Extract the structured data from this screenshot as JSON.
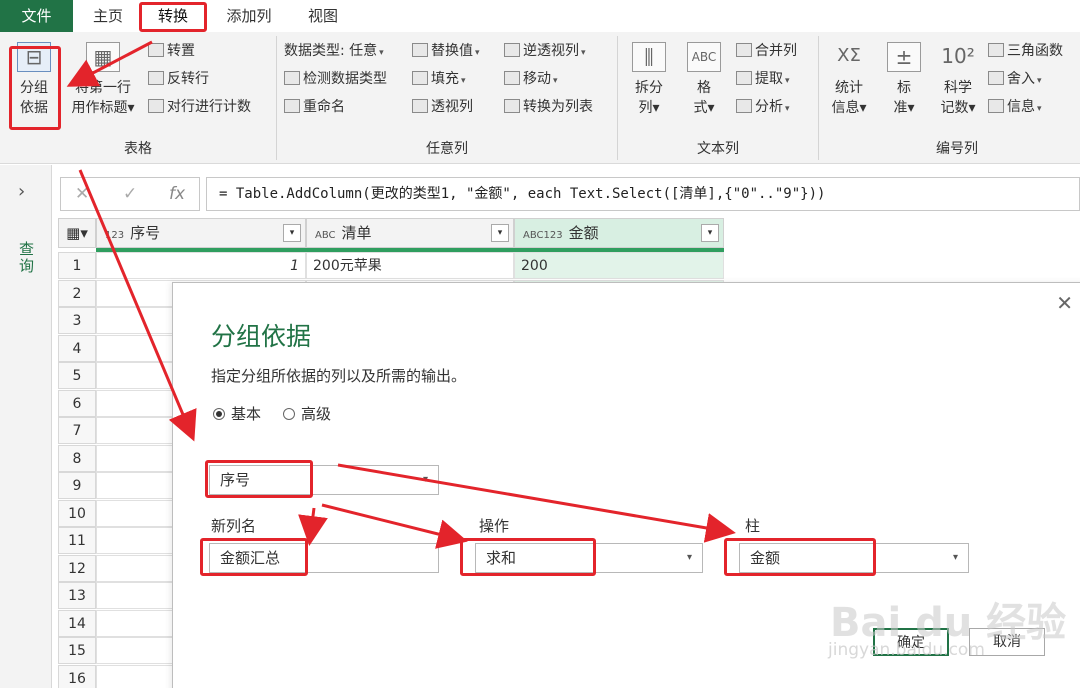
{
  "tabs": {
    "file": "文件",
    "home": "主页",
    "transform": "转换",
    "add_column": "添加列",
    "view": "视图"
  },
  "ribbon": {
    "table": {
      "group_by": [
        "分组",
        "依据"
      ],
      "use_first_row": [
        "将第一行",
        "用作标题"
      ],
      "transpose": "转置",
      "reverse_rows": "反转行",
      "count_rows": "对行进行计数",
      "label": "表格"
    },
    "any_column": {
      "data_type": "数据类型: 任意",
      "detect_type": "检测数据类型",
      "rename": "重命名",
      "replace_values": "替换值",
      "fill": "填充",
      "pivot": "透视列",
      "unpivot": "逆透视列",
      "move": "移动",
      "to_list": "转换为列表",
      "label": "任意列"
    },
    "text_column": {
      "split": [
        "拆分",
        "列"
      ],
      "format": [
        "格",
        "式"
      ],
      "merge": "合并列",
      "extract": "提取",
      "parse": "分析",
      "label": "文本列"
    },
    "number_column": {
      "statistics": [
        "统计",
        "信息"
      ],
      "standard": [
        "标",
        "准"
      ],
      "scientific": [
        "科学",
        "记数"
      ],
      "trig": "三角函数",
      "rounding": "舍入",
      "info": "信息",
      "label": "编号列",
      "sym_stat": "XΣ",
      "sym_sci": "10²"
    }
  },
  "query_pane": {
    "label": "查询"
  },
  "formula": {
    "cancel": "✕",
    "confirm": "✓",
    "fx": "fx",
    "text": "= Table.AddColumn(更改的类型1, \"金额\", each Text.Select([清单],{\"0\"..\"9\"}))"
  },
  "grid": {
    "columns": [
      {
        "type": "123",
        "name": "序号"
      },
      {
        "type": "ABC",
        "name": "清单"
      },
      {
        "type": "ABC123",
        "name": "金额"
      }
    ],
    "rows": [
      {
        "n": "1",
        "cells": [
          "1",
          "200元苹果",
          "200"
        ]
      },
      {
        "n": "2",
        "cells": [
          "",
          "",
          ""
        ]
      },
      {
        "n": "3",
        "cells": [
          "",
          "",
          ""
        ]
      },
      {
        "n": "4",
        "cells": [
          "",
          "",
          ""
        ]
      },
      {
        "n": "5",
        "cells": [
          "",
          "",
          ""
        ]
      },
      {
        "n": "6",
        "cells": [
          "",
          "",
          ""
        ]
      },
      {
        "n": "7",
        "cells": [
          "",
          "",
          ""
        ]
      },
      {
        "n": "8",
        "cells": [
          "",
          "",
          ""
        ]
      },
      {
        "n": "9",
        "cells": [
          "",
          "",
          ""
        ]
      },
      {
        "n": "10",
        "cells": [
          "",
          "",
          ""
        ]
      },
      {
        "n": "11",
        "cells": [
          "",
          "",
          ""
        ]
      },
      {
        "n": "12",
        "cells": [
          "",
          "",
          ""
        ]
      },
      {
        "n": "13",
        "cells": [
          "",
          "",
          ""
        ]
      },
      {
        "n": "14",
        "cells": [
          "",
          "",
          ""
        ]
      },
      {
        "n": "15",
        "cells": [
          "",
          "",
          ""
        ]
      },
      {
        "n": "16",
        "cells": [
          "",
          "",
          ""
        ]
      }
    ]
  },
  "dialog": {
    "title": "分组依据",
    "description": "指定分组所依据的列以及所需的输出。",
    "mode_basic": "基本",
    "mode_advanced": "高级",
    "group_column": "序号",
    "new_col_label": "新列名",
    "new_col_value": "金额汇总",
    "operation_label": "操作",
    "operation_value": "求和",
    "column_label": "柱",
    "column_value": "金额",
    "ok": "确定",
    "cancel": "取消",
    "close": "✕"
  },
  "watermark": {
    "brand": "Bai du 经验",
    "url": "jingyan.baidu.com"
  },
  "colors": {
    "accent": "#217346",
    "annotation": "#e3242b",
    "selected_column": "#d8efe2"
  }
}
